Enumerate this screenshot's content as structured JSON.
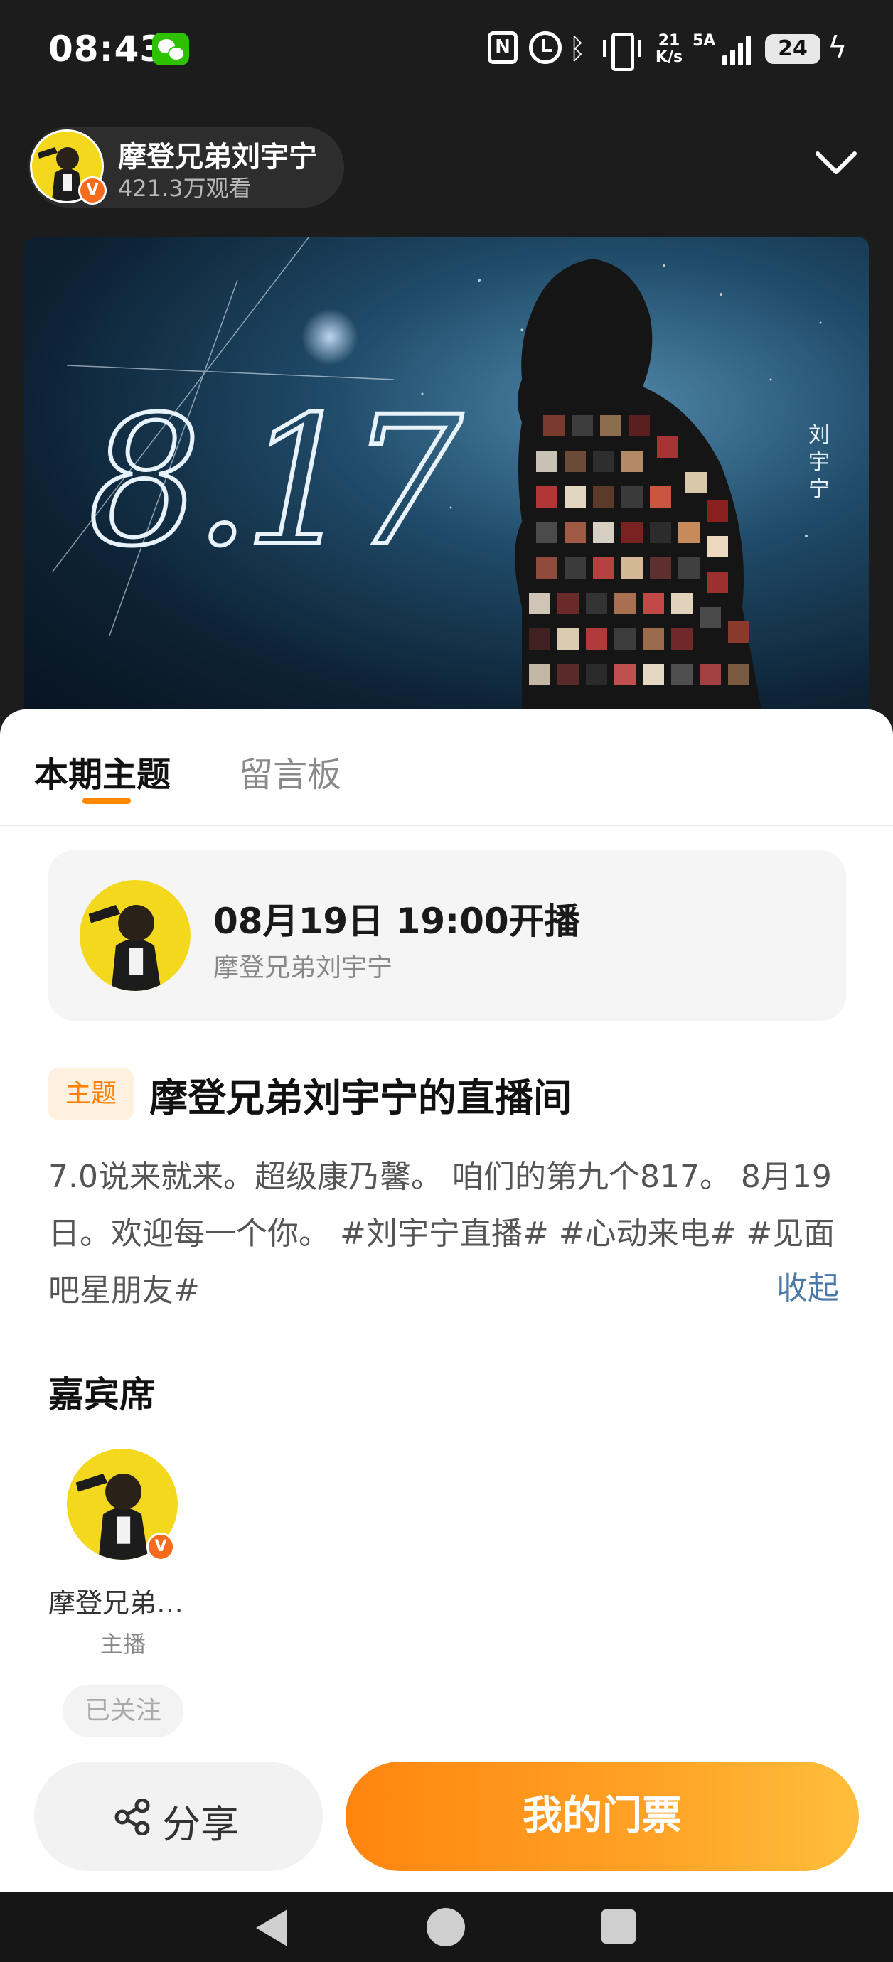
{
  "status_bar": {
    "time": "08:43",
    "net_speed_value": "21",
    "net_speed_unit": "K/s",
    "network_label": "5A",
    "battery_level": "24",
    "icons": [
      "wechat-icon",
      "nfc-icon",
      "alarm-icon",
      "bluetooth-icon",
      "vibrate-icon",
      "signal-icon",
      "battery-icon",
      "charging-icon"
    ]
  },
  "live_header": {
    "host_name": "摩登兄弟刘宇宁",
    "viewers": "421.3万观看",
    "verified_mark": "V"
  },
  "banner": {
    "date_art": "8.17",
    "side_text": "刘宇宁"
  },
  "tabs": [
    {
      "label": "本期主题",
      "active": true
    },
    {
      "label": "留言板",
      "active": false
    }
  ],
  "schedule": {
    "time": "08月19日 19:00开播",
    "host": "摩登兄弟刘宇宁"
  },
  "topic": {
    "tag": "主题",
    "title": "摩登兄弟刘宇宁的直播间",
    "description": "7.0说来就来。超级康乃馨。 咱们的第九个817。 8月19日。欢迎每一个你。 #刘宇宁直播# #心动来电# #见面吧星朋友#",
    "collapse_label": "收起"
  },
  "guests": {
    "title": "嘉宾席",
    "items": [
      {
        "name": "摩登兄弟…",
        "role": "主播",
        "follow_label": "已关注",
        "verified_mark": "V"
      }
    ]
  },
  "actions": {
    "share_label": "分享",
    "ticket_label": "我的门票"
  },
  "colors": {
    "accent": "#ff8a00",
    "ticket_gradient_start": "#ff8510",
    "ticket_gradient_end": "#ffbe3a",
    "link": "#4c7aa8",
    "avatar_background": "#f3d81e"
  }
}
